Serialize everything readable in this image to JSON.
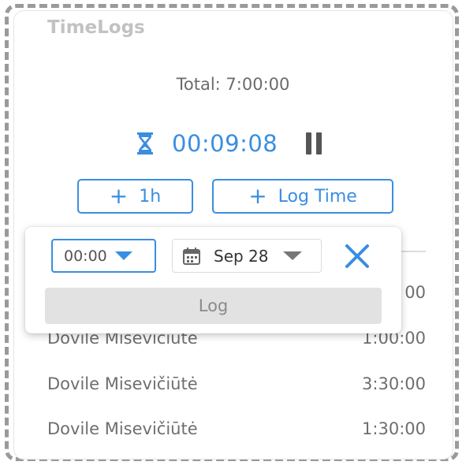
{
  "app": {
    "title": "TimeLogs"
  },
  "summary": {
    "total": "Total: 7:00:00"
  },
  "timer": {
    "value": "00:09:08"
  },
  "actions": {
    "add_hour": "1h",
    "log_time": "Log Time"
  },
  "popover": {
    "time_value": "00:00",
    "date_value": "Sep 28",
    "log_label": "Log"
  },
  "entries": [
    {
      "name": "",
      "duration": "00"
    },
    {
      "name": "Dovile Misevičiūtė",
      "duration": "1:00:00"
    },
    {
      "name": "Dovile Misevičiūtė",
      "duration": "3:30:00"
    },
    {
      "name": "Dovile Misevičiūtė",
      "duration": "1:30:00"
    }
  ],
  "colors": {
    "accent": "#3a8ee0",
    "muted": "#6e6e6e",
    "title": "#c2c2c2"
  },
  "icons": [
    "hourglass-icon",
    "pause-icon",
    "plus-icon",
    "calendar-icon",
    "chevron-down-icon",
    "close-icon"
  ]
}
